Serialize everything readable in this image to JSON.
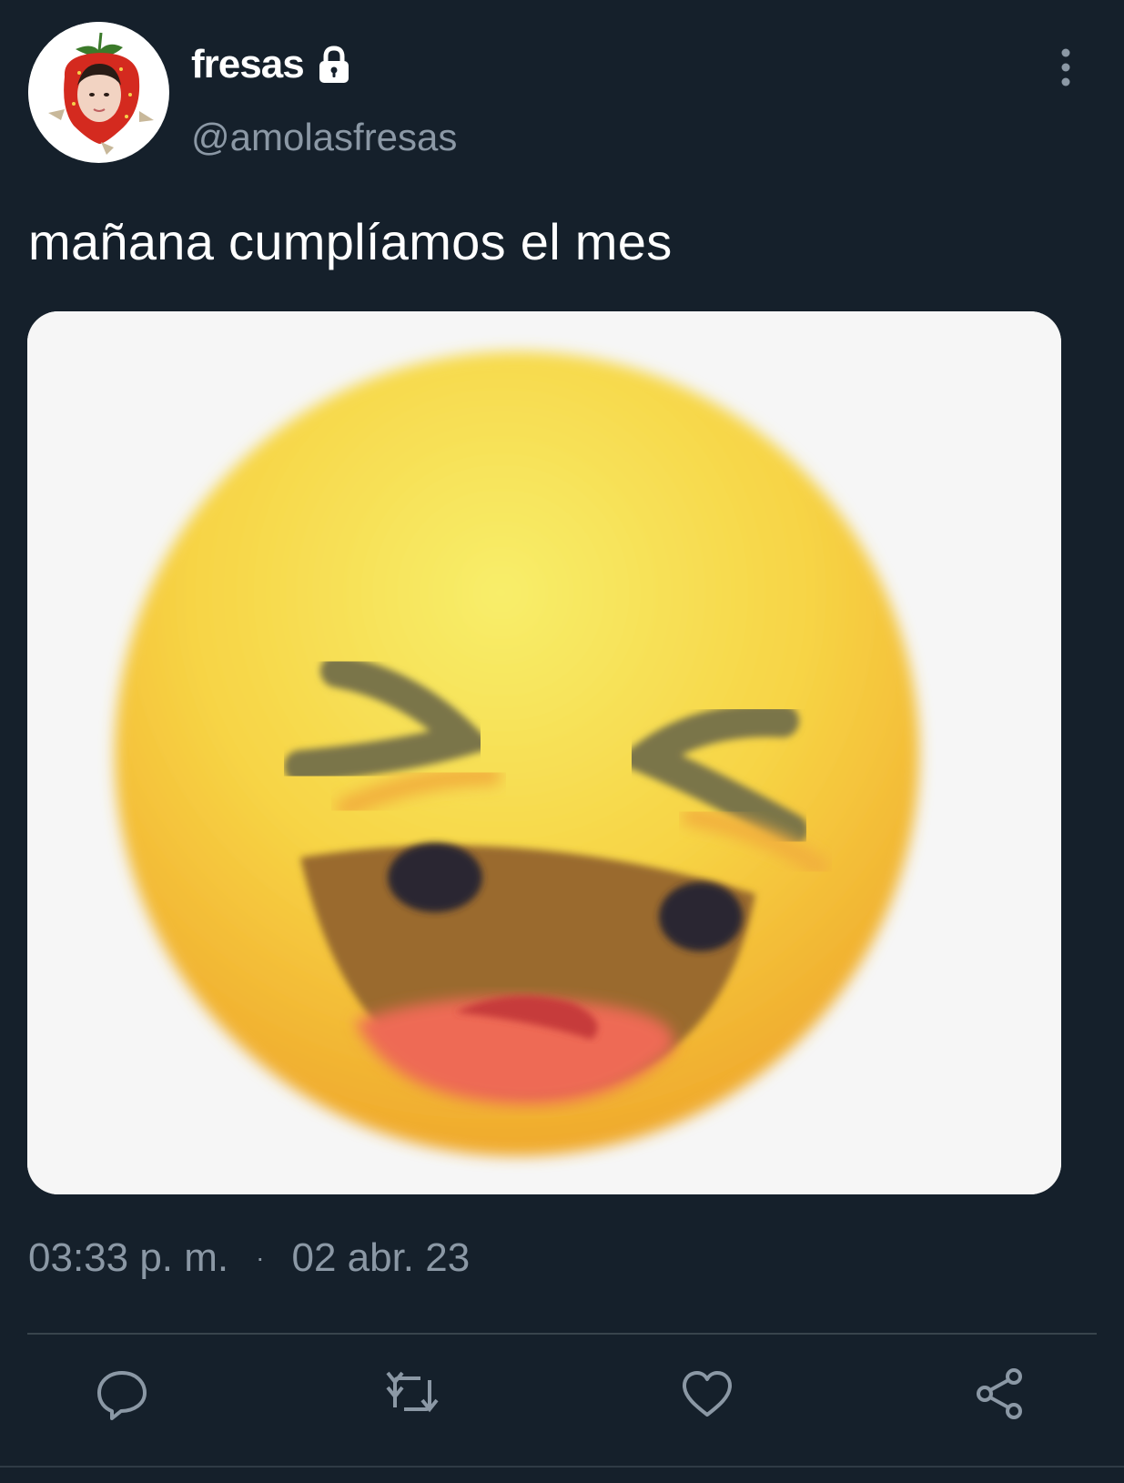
{
  "user": {
    "display_name": "fresas",
    "handle": "@amolasfresas",
    "avatar_icon": "strawberry-costume-avatar",
    "protected": true
  },
  "tweet": {
    "text": "mañana cumplíamos el mes",
    "media_description_icon": "laughing-emoji-image",
    "time": "03:33 p. m.",
    "separator": "·",
    "date": "02 abr. 23"
  },
  "actions": {
    "reply_icon": "reply-icon",
    "retweet_icon": "retweet-icon",
    "like_icon": "heart-icon",
    "share_icon": "share-icon"
  },
  "colors": {
    "background": "#15202b",
    "primary_text": "#ffffff",
    "secondary_text": "#8b98a5",
    "divider": "#38444d"
  }
}
